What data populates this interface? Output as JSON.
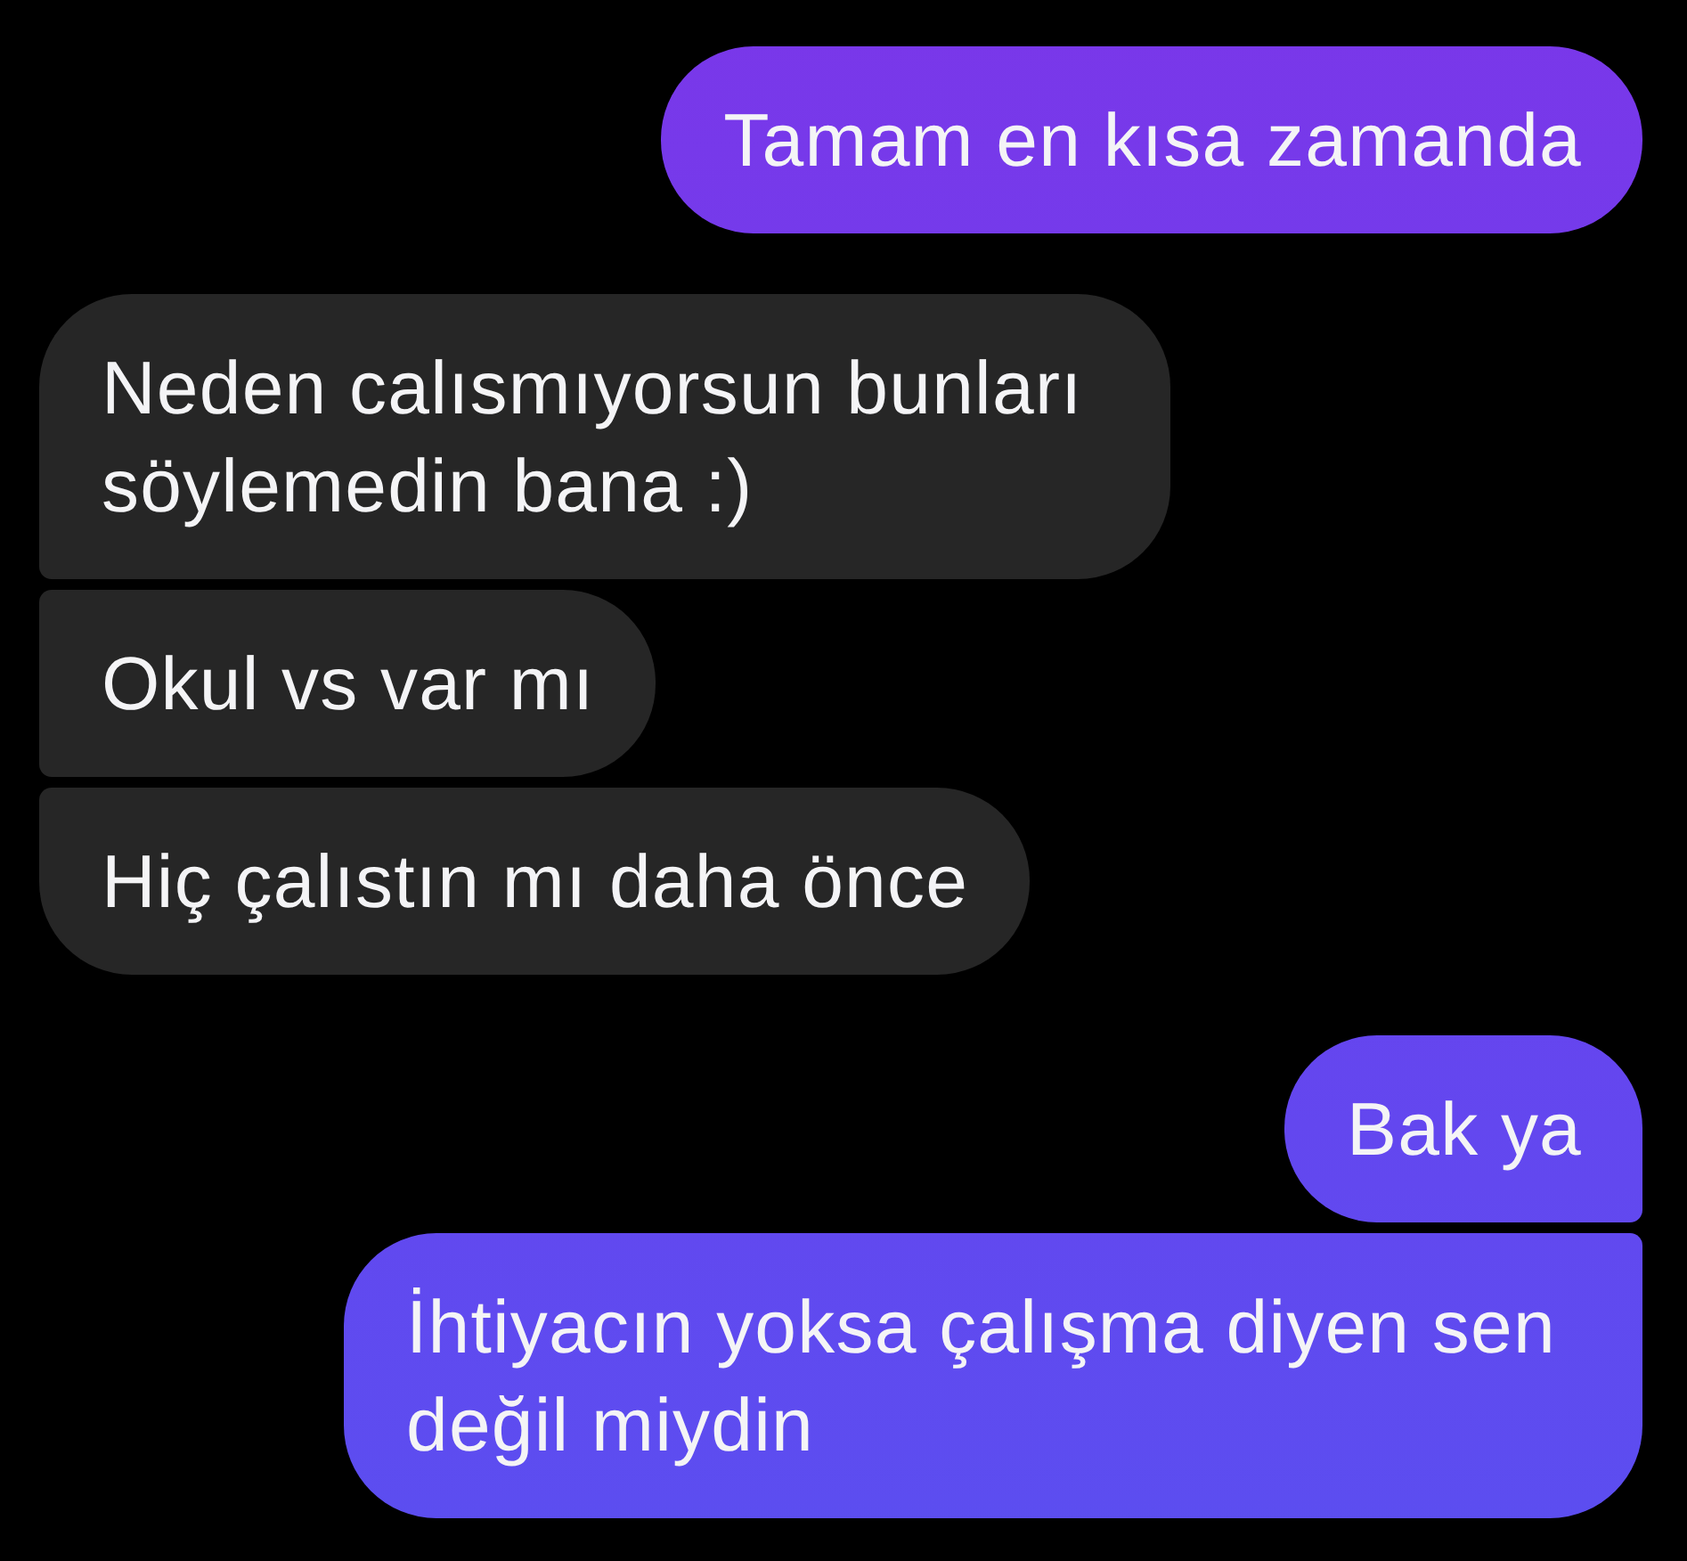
{
  "messages": [
    {
      "kind": "sent",
      "text": "Tamam en kısa zamanda"
    },
    {
      "kind": "received",
      "text": "Neden calısmıyorsun bunları söylemedin bana :)"
    },
    {
      "kind": "received",
      "text": "Okul vs var mı"
    },
    {
      "kind": "received",
      "text": "Hiç çalıstın mı daha önce"
    },
    {
      "kind": "sent",
      "text": "Bak ya"
    },
    {
      "kind": "sent",
      "text": "İhtiyacın yoksa çalışma diyen sen değil miydin"
    }
  ]
}
